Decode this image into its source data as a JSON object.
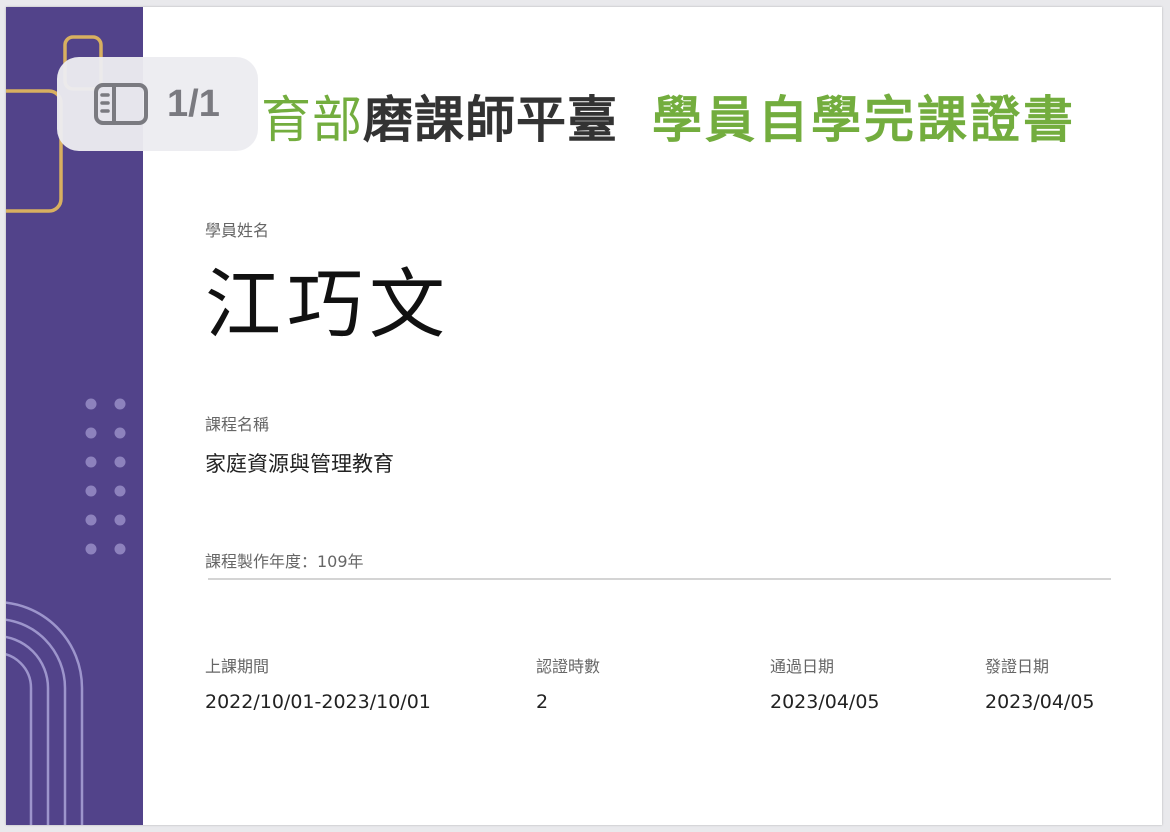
{
  "header": {
    "title_prefix": "育部",
    "title_brand": "磨課師平臺",
    "title_cert": "學員自學完課證書"
  },
  "student": {
    "label": "學員姓名",
    "name": "江巧文"
  },
  "course": {
    "label": "課程名稱",
    "name": "家庭資源與管理教育",
    "year_text": "課程製作年度：109年"
  },
  "details": {
    "period_label": "上課期間",
    "period_value": "2022/10/01-2023/10/01",
    "hours_label": "認證時數",
    "hours_value": "2",
    "pass_label": "通過日期",
    "pass_value": "2023/04/05",
    "issue_label": "發證日期",
    "issue_value": "2023/04/05"
  },
  "viewer": {
    "page_indicator": "1/1",
    "icon": "sidebar-toggle-icon"
  },
  "colors": {
    "sidebar": "#52438a",
    "accent_green": "#73ad3e",
    "gold": "#d8b060"
  }
}
